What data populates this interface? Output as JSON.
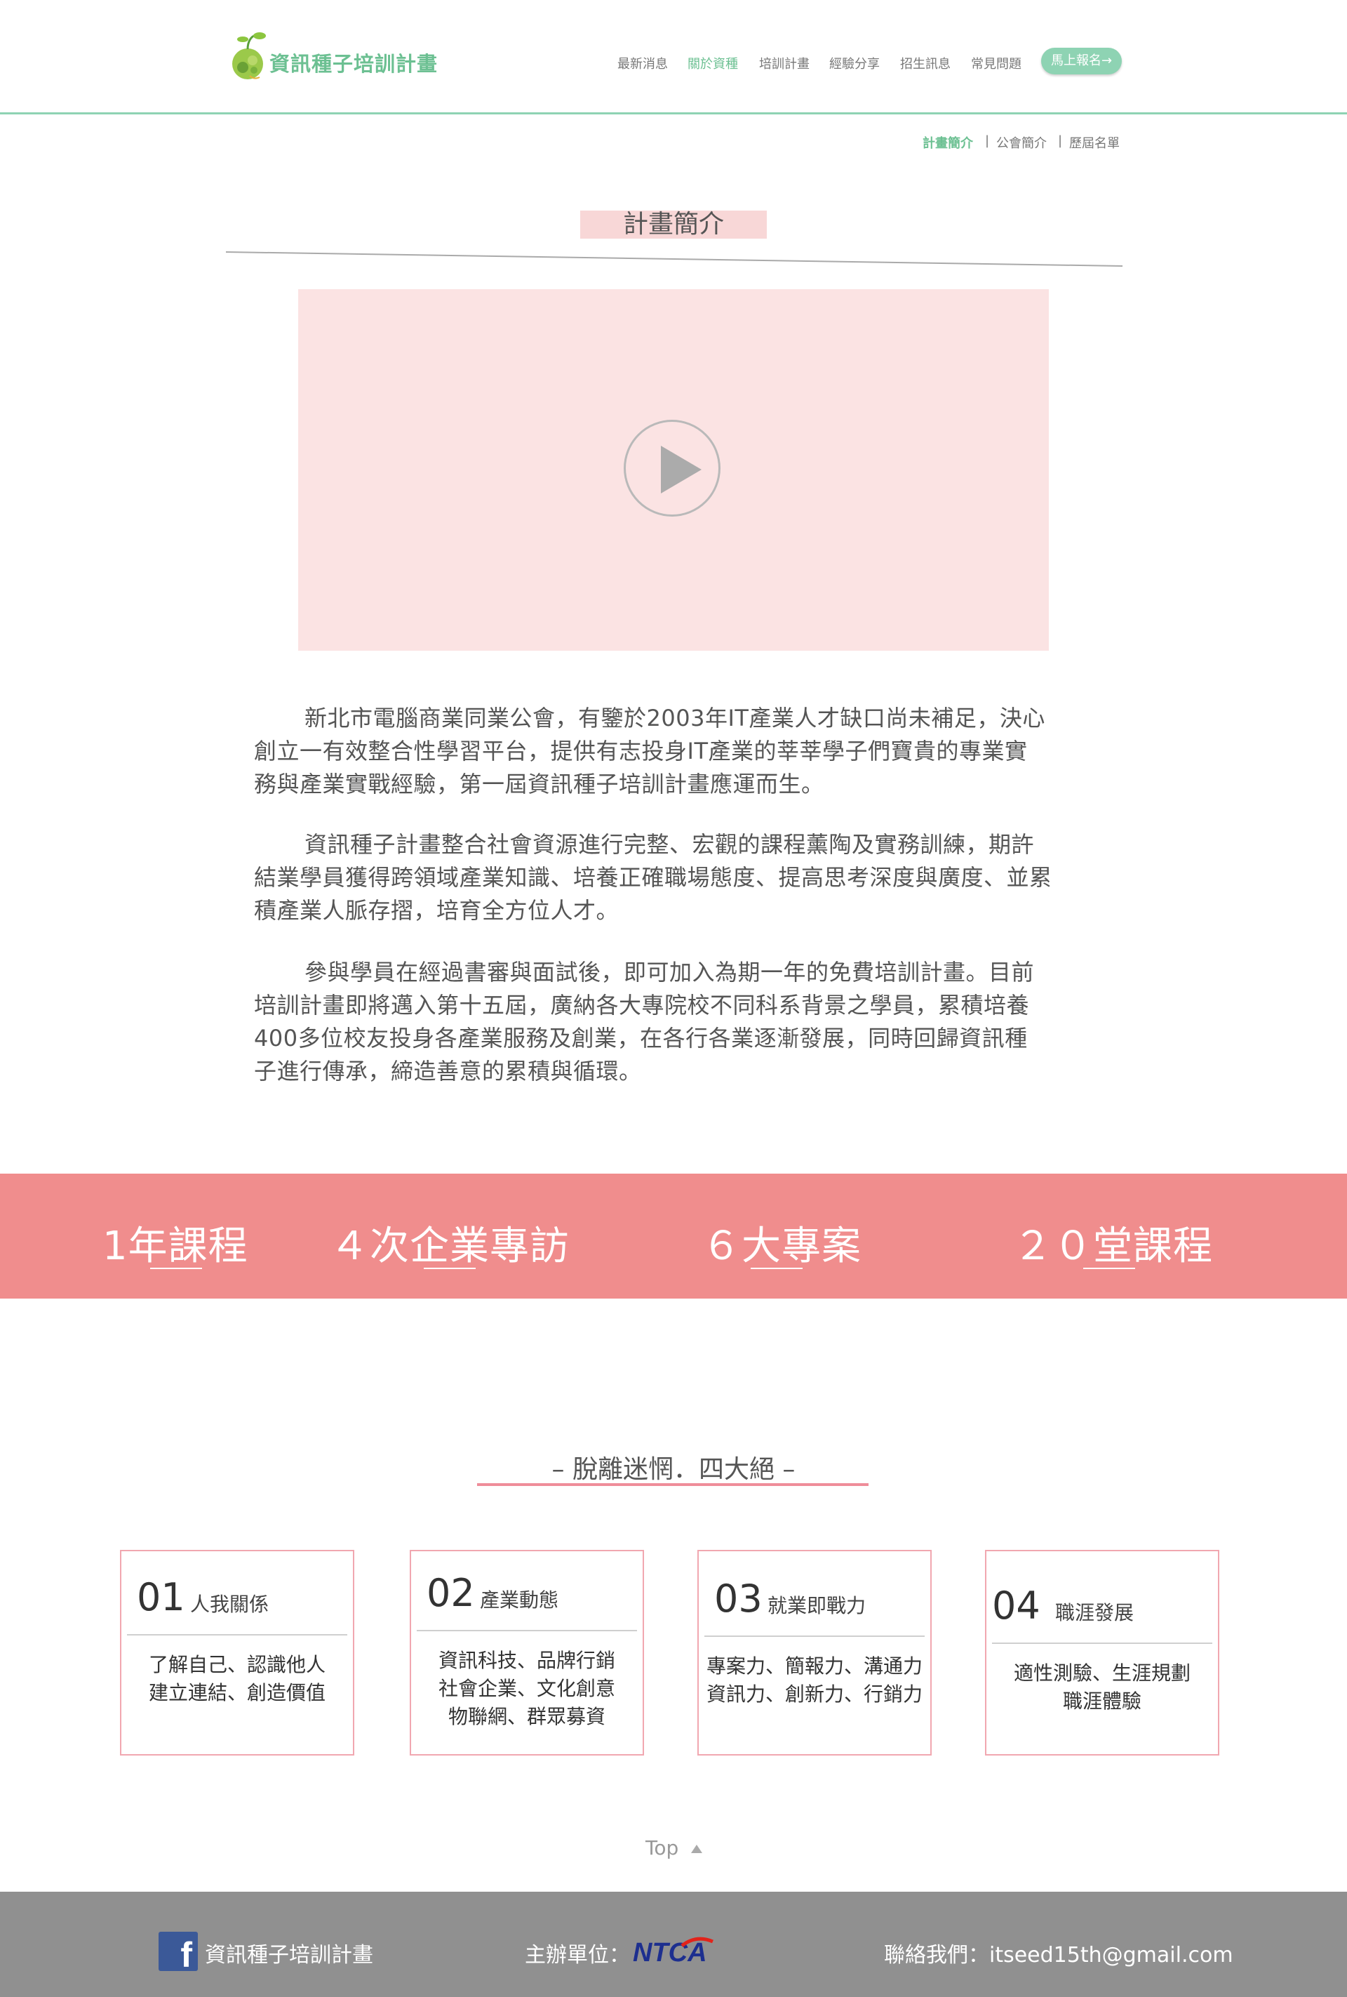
{
  "header": {
    "logo_text": "資訊種子培訓計畫",
    "nav": [
      {
        "label": "最新消息",
        "active": false
      },
      {
        "label": "關於資種",
        "active": true
      },
      {
        "label": "培訓計畫",
        "active": false
      },
      {
        "label": "經驗分享",
        "active": false
      },
      {
        "label": "招生訊息",
        "active": false
      },
      {
        "label": "常見問題",
        "active": false
      }
    ],
    "signup_label": "馬上報名→"
  },
  "subnav": {
    "items": [
      "計畫簡介",
      "公會簡介",
      "歷屆名單"
    ],
    "separator": "|",
    "active_index": 0
  },
  "intro": {
    "title": "計畫簡介",
    "video": {
      "icon": "play-icon"
    },
    "paragraphs": [
      [
        "新北市電腦商業同業公會，有鑒於2003年IT產業人才缺口尚未補足，決心",
        "創立一有效整合性學習平台，提供有志投身IT產業的莘莘學子們寶貴的專業實",
        "務與產業實戰經驗，第一屆資訊種子培訓計畫應運而生。"
      ],
      [
        "資訊種子計畫整合社會資源進行完整、宏觀的課程薰陶及實務訓練，期許",
        "結業學員獲得跨領域產業知識、培養正確職場態度、提高思考深度與廣度、並累",
        "積產業人脈存摺，培育全方位人才。"
      ],
      [
        "參與學員在經過書審與面試後，即可加入為期一年的免費培訓計畫。目前",
        "培訓計畫即將邁入第十五屆，廣納各大專院校不同科系背景之學員，累積培養",
        "400多位校友投身各產業服務及創業，在各行各業逐漸發展，同時回歸資訊種",
        "子進行傳承，締造善意的累積與循環。"
      ]
    ]
  },
  "stats": [
    "1年課程",
    "４次企業專訪",
    "６大專案",
    "２０堂課程"
  ],
  "features": {
    "title": "– 脫離迷惘．四大絕 –",
    "cards": [
      {
        "number": "01",
        "label": "人我關係",
        "lines": [
          "了解自己、認識他人",
          "建立連結、創造價值"
        ]
      },
      {
        "number": "02",
        "label": "產業動態",
        "lines": [
          "資訊科技、品牌行銷",
          "社會企業、文化創意",
          "物聯網、群眾募資"
        ]
      },
      {
        "number": "03",
        "label": "就業即戰力",
        "lines": [
          "專案力、簡報力、溝通力",
          "資訊力、創新力、行銷力"
        ]
      },
      {
        "number": "04",
        "label": "職涯發展",
        "lines": [
          "適性測驗、生涯規劃",
          "職涯體驗"
        ]
      }
    ]
  },
  "top_label": "Top",
  "footer": {
    "facebook_label": "資訊種子培訓計畫",
    "organizer_label": "主辦單位：",
    "organizer_logo_text": "NTCA",
    "contact": "聯絡我們：itseed15th@gmail.com"
  },
  "colors": {
    "green": "#6cc092",
    "mint": "#8ed3b3",
    "pink_band": "#f08d8d",
    "video_bg": "#fbe3e3",
    "footer": "#909090"
  }
}
